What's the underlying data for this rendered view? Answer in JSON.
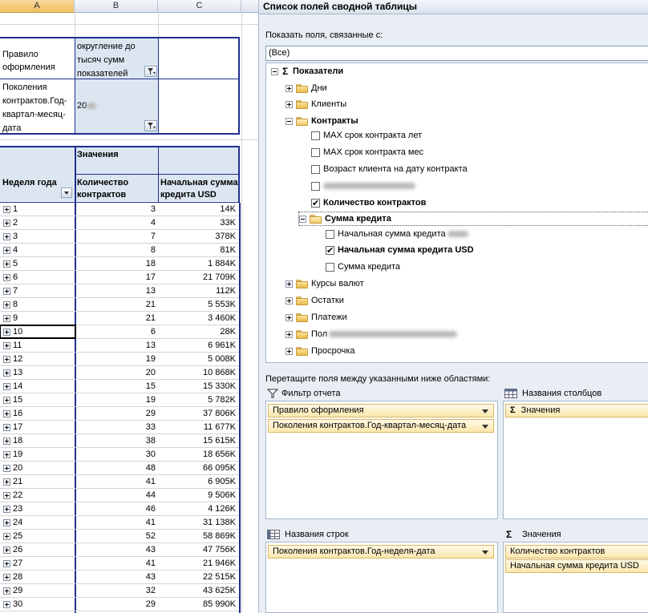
{
  "sheet": {
    "columns": [
      "A",
      "B",
      "C"
    ],
    "filter1_label": "Правило оформления",
    "filter1_value": "округление до тысяч сумм показателей",
    "filter2_label": "Поколения контрактов.Год-квартал-месяц-дата",
    "filter2_value": "20",
    "values_header": "Значения",
    "row_header": "Неделя года",
    "col1_header": "Количество контрактов",
    "col2_header": "Начальная сумма кредита USD",
    "rows": [
      {
        "week": "1",
        "count": "3",
        "amount": "14K"
      },
      {
        "week": "2",
        "count": "4",
        "amount": "33K"
      },
      {
        "week": "3",
        "count": "7",
        "amount": "378K"
      },
      {
        "week": "4",
        "count": "8",
        "amount": "81K"
      },
      {
        "week": "5",
        "count": "18",
        "amount": "1 884K"
      },
      {
        "week": "6",
        "count": "17",
        "amount": "21 709K"
      },
      {
        "week": "7",
        "count": "13",
        "amount": "112K"
      },
      {
        "week": "8",
        "count": "21",
        "amount": "5 553K"
      },
      {
        "week": "9",
        "count": "21",
        "amount": "3 460K"
      },
      {
        "week": "10",
        "count": "6",
        "amount": "28K"
      },
      {
        "week": "11",
        "count": "13",
        "amount": "6 961K"
      },
      {
        "week": "12",
        "count": "19",
        "amount": "5 008K"
      },
      {
        "week": "13",
        "count": "20",
        "amount": "10 868K"
      },
      {
        "week": "14",
        "count": "15",
        "amount": "15 330K"
      },
      {
        "week": "15",
        "count": "19",
        "amount": "5 782K"
      },
      {
        "week": "16",
        "count": "29",
        "amount": "37 806K"
      },
      {
        "week": "17",
        "count": "33",
        "amount": "11 677K"
      },
      {
        "week": "18",
        "count": "38",
        "amount": "15 615K"
      },
      {
        "week": "19",
        "count": "30",
        "amount": "18 656K"
      },
      {
        "week": "20",
        "count": "48",
        "amount": "66 095K"
      },
      {
        "week": "21",
        "count": "41",
        "amount": "6 905K"
      },
      {
        "week": "22",
        "count": "44",
        "amount": "9 506K"
      },
      {
        "week": "23",
        "count": "46",
        "amount": "4 126K"
      },
      {
        "week": "24",
        "count": "41",
        "amount": "31 138K"
      },
      {
        "week": "25",
        "count": "52",
        "amount": "58 869K"
      },
      {
        "week": "26",
        "count": "43",
        "amount": "47 756K"
      },
      {
        "week": "27",
        "count": "41",
        "amount": "21 946K"
      },
      {
        "week": "28",
        "count": "43",
        "amount": "22 515K"
      },
      {
        "week": "29",
        "count": "32",
        "amount": "43 625K"
      },
      {
        "week": "30",
        "count": "29",
        "amount": "85 990K"
      }
    ]
  },
  "pane": {
    "title": "Список полей сводной таблицы",
    "show_label": "Показать поля, связанные с:",
    "show_value": "(Все)",
    "tree": {
      "root": "Показатели",
      "days": "Дни",
      "clients": "Клиенты",
      "contracts": "Контракты",
      "max_years": "MAX срок контракта лет",
      "max_months": "MAX срок контракта мес",
      "client_age": "Возраст клиента на дату контракта",
      "contract_count": "Количество контрактов",
      "credit_sum": "Сумма кредита",
      "initial_sum": "Начальная сумма кредита",
      "initial_sum_usd": "Начальная сумма кредита USD",
      "credit_sum_item": "Сумма кредита",
      "rates": "Курсы валют",
      "balances": "Остатки",
      "payments": "Платежи",
      "generations_prefix": "Пол",
      "overdue": "Просрочка"
    },
    "drag_label": "Перетащите поля между указанными ниже областями:",
    "report_filter_title": "Фильтр отчета",
    "report_filter_items": [
      "Правило оформления",
      "Поколения контрактов.Год-квартал-месяц-дата"
    ],
    "column_labels_title": "Названия столбцов",
    "column_labels_items": [
      "Значения"
    ],
    "row_labels_title": "Названия строк",
    "row_labels_items": [
      "Поколения контрактов.Год-неделя-дата"
    ],
    "values_title": "Значения",
    "values_items": [
      "Количество контрактов",
      "Начальная сумма кредита USD"
    ],
    "sigma": "Σ"
  }
}
